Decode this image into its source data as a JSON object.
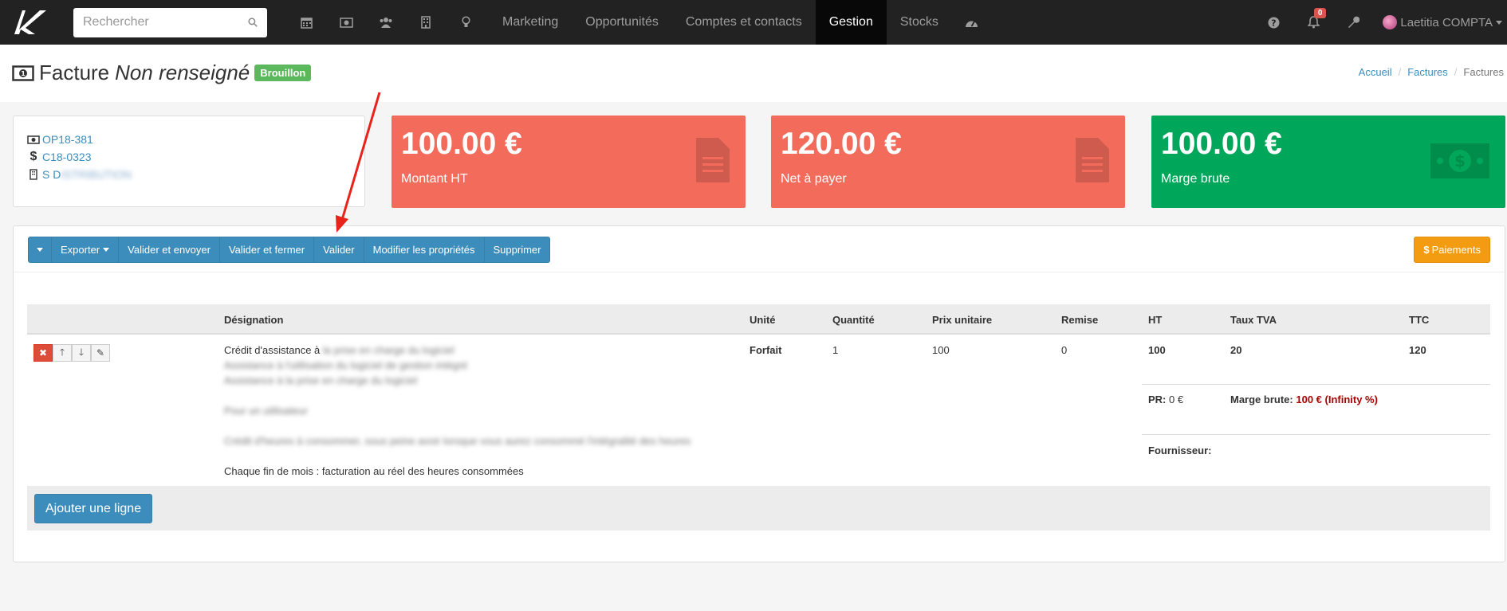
{
  "search": {
    "placeholder": "Rechercher"
  },
  "nav": {
    "icons": [
      "calendar-icon",
      "money-icon",
      "users-icon",
      "building-icon",
      "lightbulb-icon"
    ],
    "links": [
      "Marketing",
      "Opportunités",
      "Comptes et contacts",
      "Gestion",
      "Stocks"
    ],
    "active": "Gestion",
    "notifications": "0",
    "user": "Laetitia COMPTA"
  },
  "header": {
    "title": "Facture",
    "title_italic": "Non renseigné",
    "status": "Brouillon",
    "breadcrumb": [
      "Accueil",
      "Factures",
      "Factures"
    ]
  },
  "refs": {
    "opportunity": "OP18-381",
    "account": "C18-0323",
    "company_visible": "S D",
    "company_blurred": "ISTRIBUTION"
  },
  "stats": [
    {
      "value": "100.00 €",
      "label": "Montant HT",
      "color": "#f26b5b",
      "icon": "document-icon"
    },
    {
      "value": "120.00 €",
      "label": "Net à payer",
      "color": "#f26b5b",
      "icon": "document-icon"
    },
    {
      "value": "100.00 €",
      "label": "Marge brute",
      "color": "#00a65a",
      "icon": "banknote-icon"
    }
  ],
  "toolbar": {
    "export": "Exporter",
    "validate_send": "Valider et envoyer",
    "validate_close": "Valider et fermer",
    "validate": "Valider",
    "edit_props": "Modifier les propriétés",
    "delete": "Supprimer",
    "payments": "Paiements"
  },
  "table": {
    "headers": [
      "Désignation",
      "Unité",
      "Quantité",
      "Prix unitaire",
      "Remise",
      "HT",
      "Taux TVA",
      "TTC"
    ],
    "row": {
      "designation_first": "Crédit d'assistance à",
      "designation_first_blur": "la prise en charge du logiciel",
      "designation_blur": [
        "Assistance à l'utilisation du logiciel de gestion intégré",
        "Assistance à la prise en charge du logiciel",
        "",
        "Pour un utilisateur",
        "",
        "Crédit d'heures à consommer, sous peine avoir lorsque vous aurez consommé l'intégralité des heures"
      ],
      "designation_last": "Chaque fin de mois : facturation au réel des heures consommées",
      "unit": "Forfait",
      "quantity": "1",
      "unit_price": "100",
      "discount": "0",
      "ht": "100",
      "vat": "20",
      "ttc": "120",
      "pr_label": "PR:",
      "pr_value": "0 €",
      "margin_label": "Marge brute:",
      "margin_value": "100 € (Infinity %)",
      "supplier_label": "Fournisseur:"
    },
    "add_line": "Ajouter une ligne"
  },
  "colors": {
    "navbar": "#222222",
    "primary": "#3c8dbc",
    "warning": "#f39c12",
    "danger": "#f26b5b",
    "success": "#00a65a",
    "arrow": "#e8231b"
  }
}
